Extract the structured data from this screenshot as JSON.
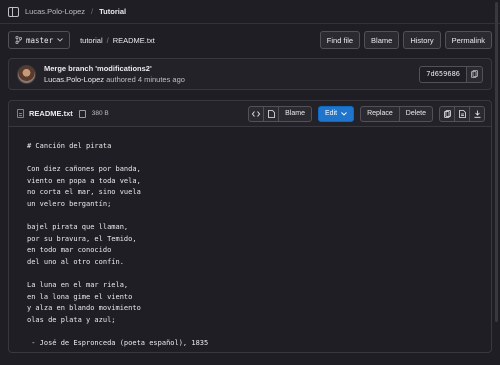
{
  "breadcrumb": {
    "owner": "Lucas.Polo-Lopez",
    "separator": "/",
    "project": "Tutorial"
  },
  "nav": {
    "branch": "master",
    "path": {
      "dir": "tutorial",
      "separator": "/",
      "file": "README.txt"
    },
    "actions": {
      "find_file": "Find file",
      "blame": "Blame",
      "history": "History",
      "permalink": "Permalink"
    }
  },
  "commit": {
    "title": "Merge branch 'modifications2'",
    "author": "Lucas.Polo-Lopez",
    "authored_text": "authored 4 minutes ago",
    "sha": "7d659686"
  },
  "file": {
    "name": "README.txt",
    "size": "380 B",
    "actions": {
      "blame": "Blame",
      "edit": "Edit",
      "replace": "Replace",
      "delete": "Delete"
    },
    "icons": {
      "source": "code-icon",
      "rendered": "document-icon",
      "copy": "copy-icon",
      "raw": "file-raw-icon",
      "download": "download-icon"
    },
    "content": "# Canción del pirata\n\nCon diez cañones por banda,\nviento en popa a toda vela,\nno corta el mar, sino vuela\nun velero bergantín;\n\nbajel pirata que llaman,\npor su bravura, el Temido,\nen todo mar conocido\ndel uno al otro confín.\n\nLa luna en el mar riela,\nen la lona gime el viento\ny alza en blando movimiento\nolas de plata y azul;\n\n - José de Espronceda (poeta español), 1835"
  },
  "colors": {
    "accent": "#1f75cb",
    "background": "#1f1e24",
    "border": "#535158"
  }
}
